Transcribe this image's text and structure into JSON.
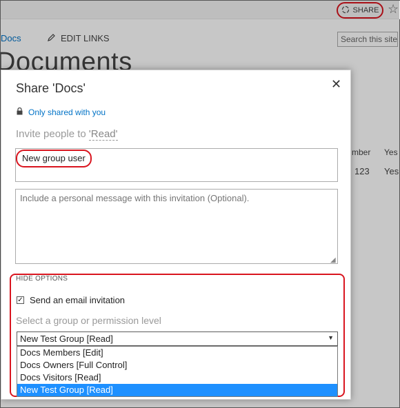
{
  "topbar": {
    "share_label": "SHARE",
    "star_icon": "star-icon",
    "share_icon": "share-icon"
  },
  "page": {
    "breadcrumb": "Docs",
    "edit_links": "EDIT LINKS",
    "search_placeholder": "Search this site",
    "title": "Documents",
    "columns": {
      "member_header": "mber",
      "yes_header": "Yes o",
      "member_value": "123",
      "yes_value": "Yes"
    }
  },
  "dialog": {
    "title": "Share 'Docs'",
    "close": "✕",
    "shared_status": "Only shared with you",
    "invite_prefix": "Invite people to ",
    "invite_permission": "'Read'",
    "people_value": "New group user",
    "message_placeholder": "Include a personal message with this invitation (Optional).",
    "hide_options": "HIDE OPTIONS",
    "email_invitation_label": "Send an email invitation",
    "email_invitation_checked": true,
    "select_label": "Select a group or permission level",
    "selected_value": "New Test Group [Read]",
    "options": [
      "Docs Members [Edit]",
      "Docs Owners [Full Control]",
      "Docs Visitors [Read]",
      "New Test Group [Read]"
    ],
    "highlight_color": "#1e90ff",
    "annotation_color": "#d9141e"
  }
}
